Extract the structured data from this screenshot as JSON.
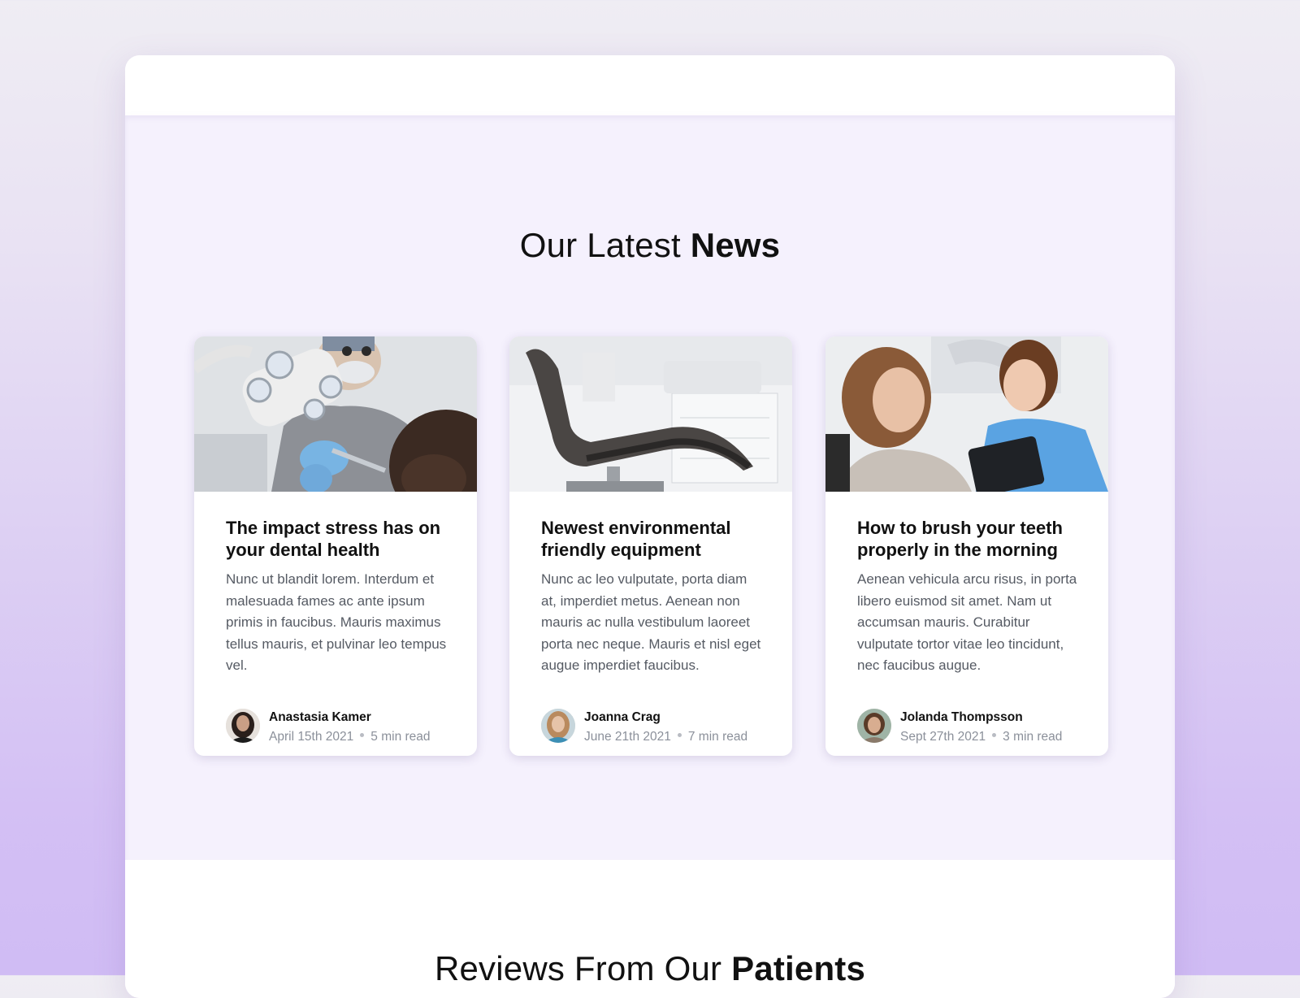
{
  "news": {
    "title_light": "Our Latest ",
    "title_bold": "News",
    "articles": [
      {
        "image": "dentist-treating-patient-photo",
        "title": "The impact stress has on your dental health",
        "excerpt": "Nunc ut blandit lorem. Interdum et malesuada fames ac ante ipsum primis in faucibus. Mauris maximus tellus mauris, et pulvinar leo tempus vel.",
        "author": "Anastasia Kamer",
        "date": "April 15th 2021",
        "read_time": "5 min read"
      },
      {
        "image": "dental-chair-equipment-photo",
        "title": "Newest environmental friendly equipment",
        "excerpt": "Nunc ac leo vulputate, porta diam at, imperdiet metus. Aenean non mauris ac nulla vestibulum laoreet porta nec neque. Mauris et nisl eget augue imperdiet faucibus.",
        "author": "Joanna Crag",
        "date": "June 21th 2021",
        "read_time": "7 min read"
      },
      {
        "image": "dentist-showing-tablet-photo",
        "title": "How to brush your teeth properly in the morning",
        "excerpt": "Aenean vehicula arcu risus, in porta libero euismod sit amet. Nam ut accumsan mauris. Curabitur vulputate tortor vitae leo tincidunt, nec faucibus augue.",
        "author": "Jolanda Thompsson",
        "date": "Sept 27th 2021",
        "read_time": "3 min read"
      }
    ]
  },
  "reviews": {
    "title_light": "Reviews From Our ",
    "title_bold": "Patients"
  },
  "colors": {
    "section_bg": "#f5f1fd",
    "accent_gradient_bottom": "#d0bcf4",
    "meta_text": "#8b909a",
    "body_text": "#555a63"
  }
}
